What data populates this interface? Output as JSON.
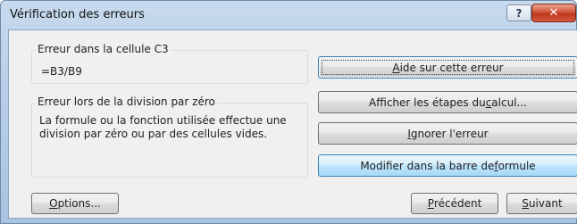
{
  "dialog": {
    "title": "Vérification des erreurs",
    "help_glyph": "?",
    "close_glyph": "✕"
  },
  "error_cell": {
    "label": "Erreur dans la cellule C3",
    "formula": "=B3/B9"
  },
  "error_type": {
    "label": "Erreur lors de la division par zéro",
    "description_line1": "La formule ou la fonction utilisée effectue une",
    "description_line2": "division par zéro ou par des cellules vides."
  },
  "buttons": {
    "help_pre": "",
    "help_key": "A",
    "help_post": "ide sur cette erreur",
    "steps_pre": "Afficher les étapes du ",
    "steps_key": "c",
    "steps_post": "alcul...",
    "ignore_pre": "",
    "ignore_key": "I",
    "ignore_post": "gnorer l'erreur",
    "edit_pre": "Modifier dans la barre de ",
    "edit_key": "f",
    "edit_post": "ormule",
    "options_pre": "",
    "options_key": "O",
    "options_post": "ptions...",
    "prev_pre": "",
    "prev_key": "P",
    "prev_post": "récédent",
    "next_pre": "",
    "next_key": "S",
    "next_post": "uivant"
  }
}
